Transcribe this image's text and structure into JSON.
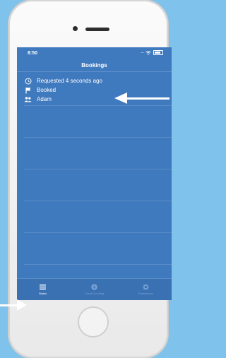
{
  "status_bar": {
    "time": "8:50"
  },
  "nav": {
    "title": "Bookings"
  },
  "booking": {
    "rows": [
      {
        "icon": "clock-icon",
        "text": "Requested 4 seconds ago"
      },
      {
        "icon": "flag-icon",
        "text": "Booked"
      },
      {
        "icon": "people-icon",
        "text": "Adam"
      }
    ]
  },
  "tabbar": {
    "items": [
      {
        "icon": "list-icon",
        "label": "Status",
        "active": true
      },
      {
        "icon": "plus-circle-icon",
        "label": "Create booking",
        "active": false
      },
      {
        "icon": "gear-icon",
        "label": "Preferences",
        "active": false
      }
    ]
  },
  "colors": {
    "background": "#7fc2ec",
    "screen": "#3f79be",
    "arrow": "#ffffff"
  }
}
